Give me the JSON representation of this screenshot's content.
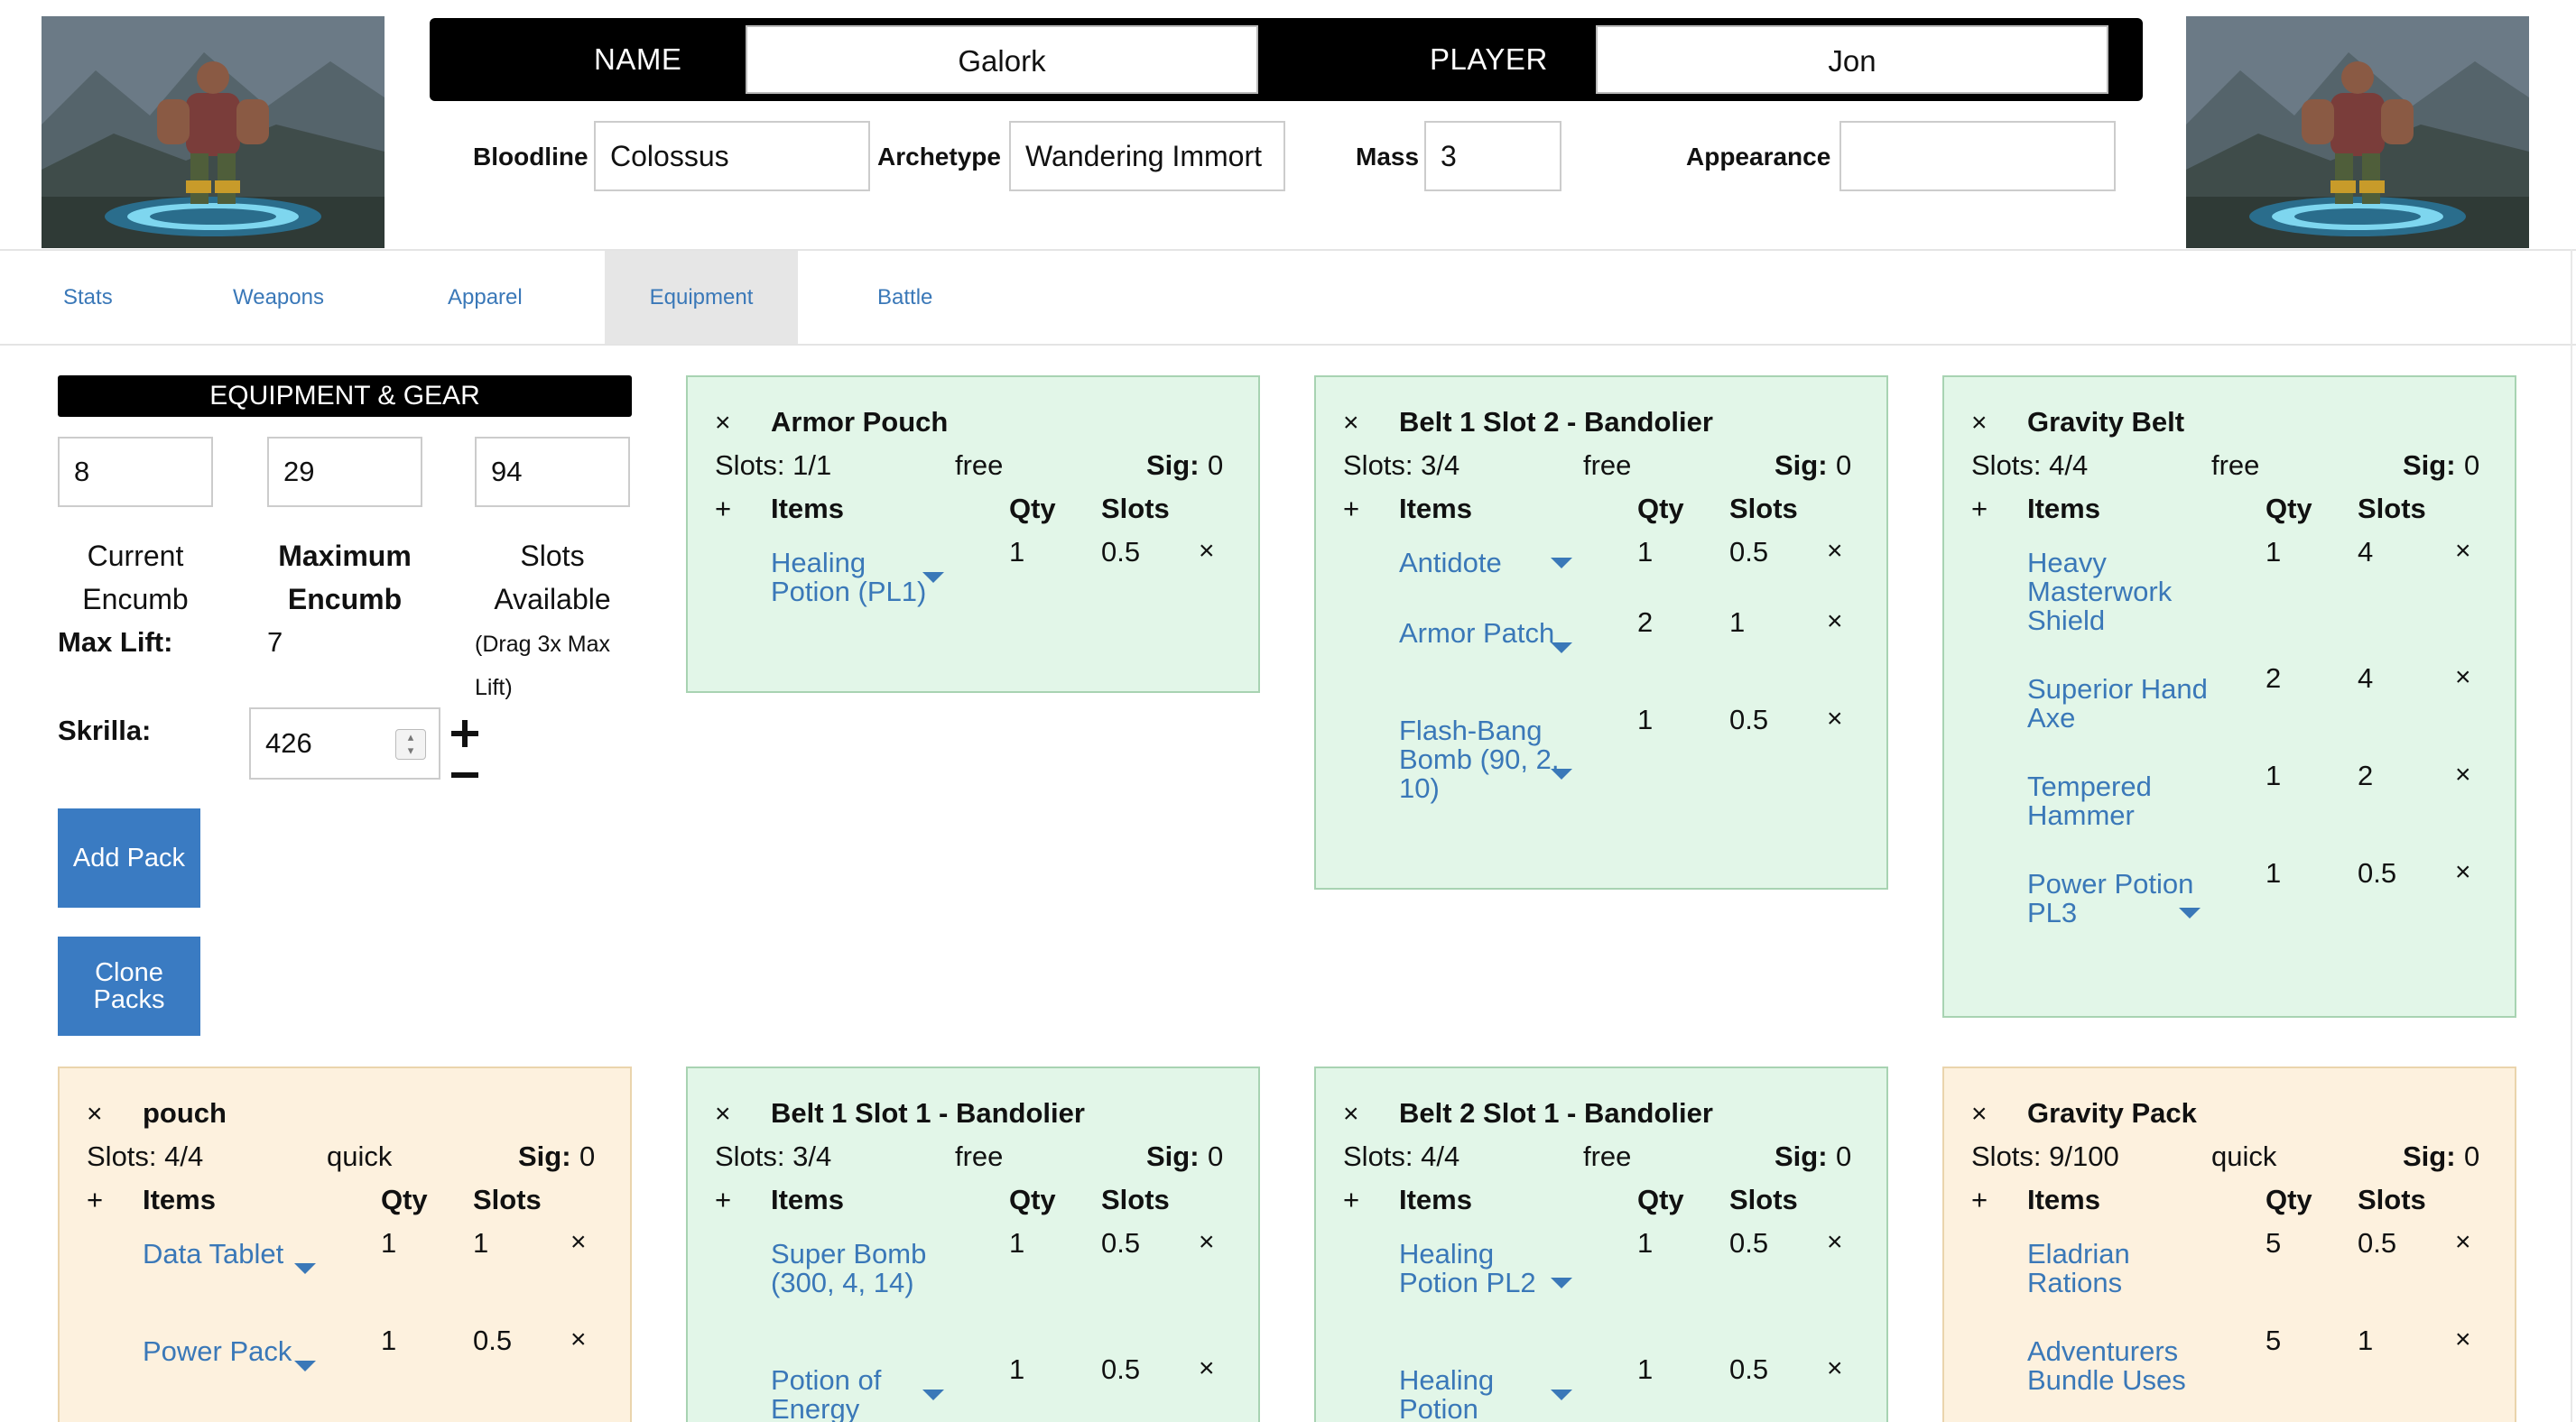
{
  "header": {
    "name_label": "NAME",
    "name_value": "Galork",
    "player_label": "PLAYER",
    "player_value": "Jon",
    "bloodline_label": "Bloodline",
    "bloodline_value": "Colossus",
    "archetype_label": "Archetype",
    "archetype_value": "Wandering Immort",
    "mass_label": "Mass",
    "mass_value": "3",
    "appearance_label": "Appearance",
    "appearance_value": ""
  },
  "tabs": [
    {
      "label": "Stats"
    },
    {
      "label": "Weapons"
    },
    {
      "label": "Apparel"
    },
    {
      "label": "Equipment",
      "active": true
    },
    {
      "label": "Battle"
    }
  ],
  "equipment": {
    "title": "EQUIPMENT & GEAR",
    "current_encumb": "8",
    "maximum_encumb": "29",
    "slots_available": "94",
    "current_caption": "Current Encumb",
    "maximum_caption": "Maximum Encumb",
    "slots_caption": "Slots Available",
    "drag_note": "(Drag 3x Max Lift)",
    "max_lift_label": "Max Lift:",
    "max_lift_value": "7",
    "skrilla_label": "Skrilla:",
    "skrilla_value": "426",
    "add_pack_label": "Add Pack",
    "clone_packs_label": "Clone Packs"
  },
  "pack_headers": {
    "items": "Items",
    "qty": "Qty",
    "slots": "Slots",
    "sig_prefix": "Sig:",
    "add_symbol": "+",
    "remove_symbol": "×"
  },
  "packs": [
    {
      "title": "Armor Pouch",
      "slots": "Slots: 1/1",
      "mode": "free",
      "sig": "0",
      "items": [
        {
          "name": "Healing Potion (PL1)",
          "qty": "1",
          "slots": "0.5",
          "dropdown": true
        }
      ]
    },
    {
      "title": "Belt 1 Slot 2 - Bandolier",
      "slots": "Slots: 3/4",
      "mode": "free",
      "sig": "0",
      "items": [
        {
          "name": "Antidote",
          "qty": "1",
          "slots": "0.5",
          "dropdown": true
        },
        {
          "name": "Armor Patch",
          "qty": "2",
          "slots": "1",
          "dropdown": true
        },
        {
          "name": "Flash-Bang Bomb (90, 2, 10)",
          "qty": "1",
          "slots": "0.5",
          "dropdown": true
        }
      ]
    },
    {
      "title": "Gravity Belt",
      "slots": "Slots: 4/4",
      "mode": "free",
      "sig": "0",
      "items": [
        {
          "name": "Heavy Masterwork Shield",
          "qty": "1",
          "slots": "4",
          "dropdown": false
        },
        {
          "name": "Superior Hand Axe",
          "qty": "2",
          "slots": "4",
          "dropdown": false
        },
        {
          "name": "Tempered Hammer",
          "qty": "1",
          "slots": "2",
          "dropdown": false
        },
        {
          "name": "Power Potion PL3",
          "qty": "1",
          "slots": "0.5",
          "dropdown": true
        }
      ]
    },
    {
      "title": "pouch",
      "slots": "Slots: 4/4",
      "mode": "quick",
      "sig": "0",
      "items": [
        {
          "name": "Data Tablet",
          "qty": "1",
          "slots": "1",
          "dropdown": true
        },
        {
          "name": "Power Pack",
          "qty": "1",
          "slots": "0.5",
          "dropdown": true
        }
      ]
    },
    {
      "title": "Belt 1 Slot 1 - Bandolier",
      "slots": "Slots: 3/4",
      "mode": "free",
      "sig": "0",
      "items": [
        {
          "name": "Super Bomb (300, 4, 14)",
          "qty": "1",
          "slots": "0.5",
          "dropdown": false
        },
        {
          "name": "Potion of Energy",
          "qty": "1",
          "slots": "0.5",
          "dropdown": true
        }
      ]
    },
    {
      "title": "Belt 2 Slot 1 - Bandolier",
      "slots": "Slots: 4/4",
      "mode": "free",
      "sig": "0",
      "items": [
        {
          "name": "Healing Potion PL2",
          "qty": "1",
          "slots": "0.5",
          "dropdown": true
        },
        {
          "name": "Healing Potion",
          "qty": "1",
          "slots": "0.5",
          "dropdown": true
        }
      ]
    },
    {
      "title": "Gravity Pack",
      "slots": "Slots: 9/100",
      "mode": "quick",
      "sig": "0",
      "items": [
        {
          "name": "Eladrian Rations",
          "qty": "5",
          "slots": "0.5",
          "dropdown": false
        },
        {
          "name": "Adventurers Bundle Uses",
          "qty": "5",
          "slots": "1",
          "dropdown": false
        }
      ]
    }
  ],
  "colors": {
    "accent": "#3a7bc2",
    "link": "#3a78b8",
    "free_pack_bg": "#e2f6e8",
    "quick_pack_bg": "#fdf1de"
  }
}
